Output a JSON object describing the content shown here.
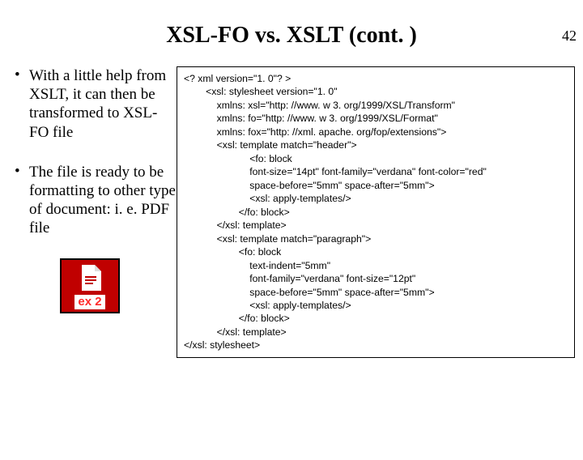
{
  "page_number": "42",
  "title": "XSL-FO vs. XSLT (cont. )",
  "bullets": [
    "With a little help from XSLT, it can then be transformed to XSL-FO file",
    "The file is ready to be formatting to other type of document: i. e. PDF file"
  ],
  "badge_label": "ex 2",
  "code": "<? xml version=\"1. 0\"? >\n        <xsl: stylesheet version=\"1. 0\"\n            xmlns: xsl=\"http: //www. w 3. org/1999/XSL/Transform\"\n            xmlns: fo=\"http: //www. w 3. org/1999/XSL/Format\"\n            xmlns: fox=\"http: //xml. apache. org/fop/extensions\">\n            <xsl: template match=\"header\">\n                        <fo: block\n                        font-size=\"14pt\" font-family=\"verdana\" font-color=\"red\"\n                        space-before=\"5mm\" space-after=\"5mm\">\n                        <xsl: apply-templates/>\n                    </fo: block>\n            </xsl: template>\n            <xsl: template match=\"paragraph\">\n                    <fo: block\n                        text-indent=\"5mm\"\n                        font-family=\"verdana\" font-size=\"12pt\"\n                        space-before=\"5mm\" space-after=\"5mm\">\n                        <xsl: apply-templates/>\n                    </fo: block>\n            </xsl: template>\n</xsl: stylesheet>"
}
